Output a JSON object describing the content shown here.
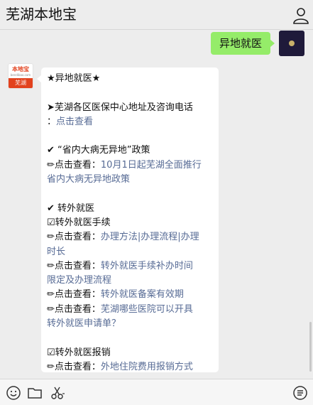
{
  "header": {
    "title": "芜湖本地宝"
  },
  "sent_message": {
    "text": "异地就医"
  },
  "bot_avatar": {
    "logo_text": "本地宝",
    "logo_subtext": "bendibao.com",
    "city_badge": "芜湖"
  },
  "reply": {
    "lines": [
      {
        "prefix": "★异地就医★",
        "link": ""
      },
      {
        "prefix": "",
        "link": ""
      },
      {
        "prefix": "➤芜湖各区医保中心地址及咨询电话",
        "link": ""
      },
      {
        "prefix": "：",
        "link": "点击查看"
      },
      {
        "prefix": "",
        "link": ""
      },
      {
        "prefix": "✔ “省内大病无异地”政策",
        "link": ""
      },
      {
        "prefix": "✏点击查看：",
        "link": "10月1日起芜湖全面推行"
      },
      {
        "prefix": "",
        "link": "省内大病无异地政策"
      },
      {
        "prefix": "",
        "link": ""
      },
      {
        "prefix": "✔ 转外就医",
        "link": ""
      },
      {
        "prefix": "☑转外就医手续",
        "link": ""
      },
      {
        "prefix": "✏点击查看：",
        "link": "办理方法|办理流程|办理"
      },
      {
        "prefix": "",
        "link": "时长"
      },
      {
        "prefix": "✏点击查看：",
        "link": "转外就医手续补办时间"
      },
      {
        "prefix": "",
        "link": "限定及办理流程"
      },
      {
        "prefix": "✏点击查看：",
        "link": "转外就医备案有效期"
      },
      {
        "prefix": "✏点击查看：",
        "link": "芜湖哪些医院可以开具"
      },
      {
        "prefix": "",
        "link": "转外就医申请单？"
      },
      {
        "prefix": "",
        "link": ""
      },
      {
        "prefix": "☑转外就医报销",
        "link": ""
      },
      {
        "prefix": "✏点击查看：",
        "link": "外地住院费用报销方式"
      }
    ]
  },
  "icons": {
    "user": "user-icon",
    "emoji": "emoji-icon",
    "folder": "folder-icon",
    "scissors": "scissors-icon",
    "chat_history": "chat-history-icon"
  },
  "colors": {
    "link": "#576b95",
    "sent_bubble": "#95ec69",
    "brand": "#e2421e"
  }
}
